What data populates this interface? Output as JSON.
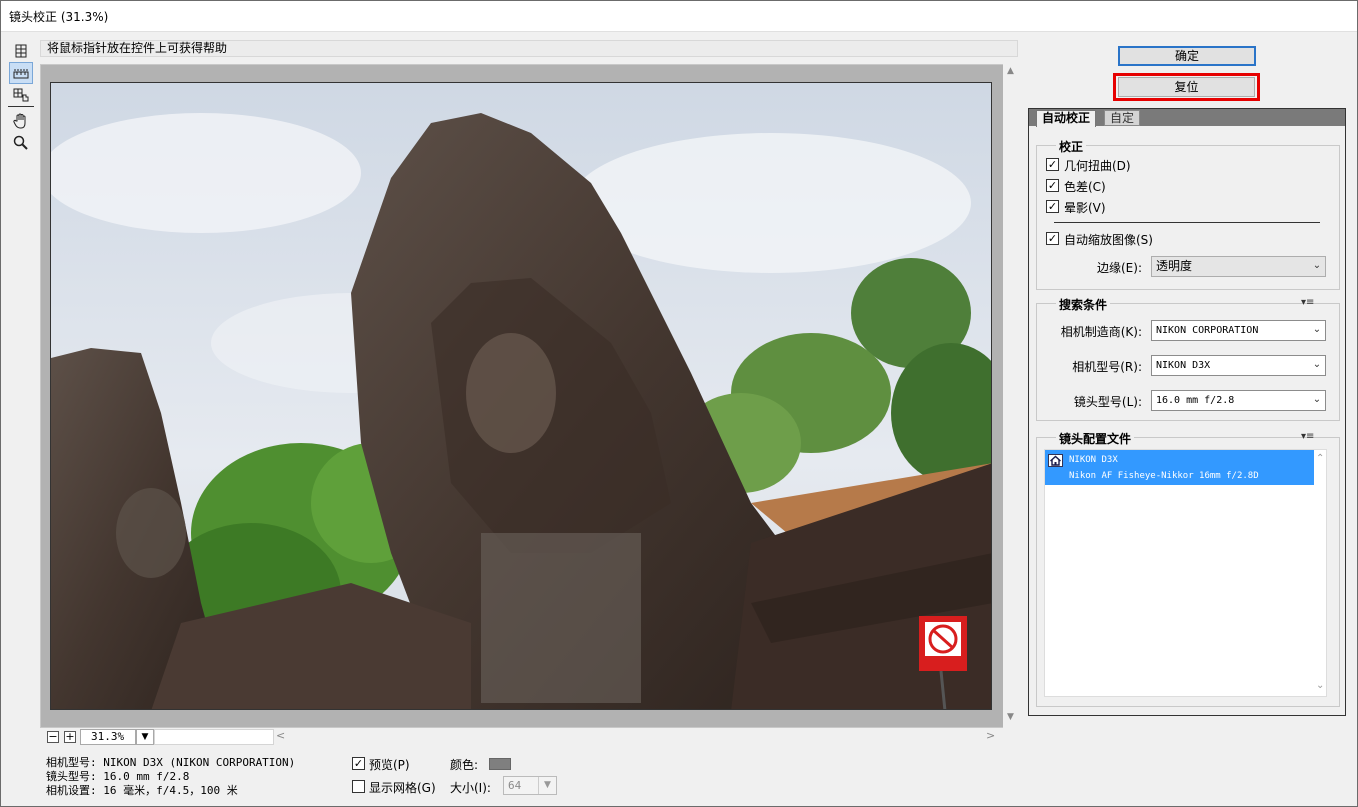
{
  "window": {
    "title": "镜头校正 (31.3%)"
  },
  "hint": "将鼠标指针放在控件上可获得帮助",
  "tools": [
    "remove-distortion-tool",
    "straighten-tool",
    "move-grid-tool",
    "hand-tool",
    "zoom-tool"
  ],
  "zoom": {
    "value": "31.3%",
    "minus": "−",
    "plus": "+"
  },
  "info": {
    "camera_model": "相机型号: NIKON D3X (NIKON CORPORATION)",
    "lens_model": "镜头型号: 16.0 mm f/2.8",
    "camera_settings": "相机设置: 16 毫米，f/4.5，100 米"
  },
  "options": {
    "preview_label": "预览(P)",
    "preview_checked": true,
    "grid_label": "显示网格(G)",
    "grid_checked": false,
    "color_label": "颜色:",
    "size_label": "大小(I):",
    "size_value": "64"
  },
  "buttons": {
    "ok": "确定",
    "reset": "复位"
  },
  "tabs": {
    "auto": "自动校正",
    "custom": "自定"
  },
  "correction": {
    "title": "校正",
    "geometric": "几何扭曲(D)",
    "chromatic": "色差(C)",
    "vignette": "晕影(V)",
    "auto_scale": "自动缩放图像(S)",
    "edge_label": "边缘(E):",
    "edge_value": "透明度"
  },
  "search": {
    "title": "搜索条件",
    "make_label": "相机制造商(K):",
    "make_value": "NIKON CORPORATION",
    "model_label": "相机型号(R):",
    "model_value": "NIKON D3X",
    "lens_label": "镜头型号(L):",
    "lens_value": "16.0 mm f/2.8"
  },
  "profiles": {
    "title": "镜头配置文件",
    "items": [
      {
        "camera": "NIKON D3X",
        "lens": "Nikon AF Fisheye-Nikkor 16mm f/2.8D"
      }
    ]
  },
  "colors": {
    "accent": "#2a74c8",
    "highlight": "#e60000",
    "selection": "#3399ff"
  }
}
